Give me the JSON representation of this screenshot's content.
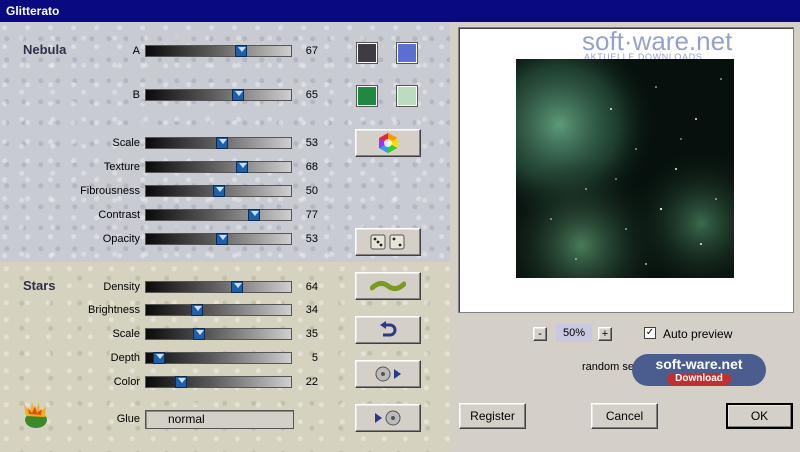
{
  "window": {
    "title": "Glitterato"
  },
  "nebula": {
    "title": "Nebula",
    "sliders": [
      {
        "label": "A",
        "value": 67
      },
      {
        "label": "B",
        "value": 65
      },
      {
        "label": "Scale",
        "value": 53
      },
      {
        "label": "Texture",
        "value": 68
      },
      {
        "label": "Fibrousness",
        "value": 50
      },
      {
        "label": "Contrast",
        "value": 77
      },
      {
        "label": "Opacity",
        "value": 53
      }
    ],
    "colors": {
      "a1": "#3e3a46",
      "a2": "#5a6fd0",
      "b1": "#1f8a3f",
      "b2": "#bcdcc0"
    }
  },
  "stars": {
    "title": "Stars",
    "sliders": [
      {
        "label": "Density",
        "value": 64
      },
      {
        "label": "Brightness",
        "value": 34
      },
      {
        "label": "Scale",
        "value": 35
      },
      {
        "label": "Depth",
        "value": 5
      },
      {
        "label": "Color",
        "value": 22
      }
    ],
    "glue": {
      "label": "Glue",
      "value": "normal"
    }
  },
  "preview": {
    "zoom": "50%",
    "zoom_minus": "-",
    "zoom_plus": "+",
    "auto_preview_label": "Auto preview",
    "auto_preview_checked": "✓",
    "random_settings_label": "random settings"
  },
  "watermark": {
    "brand": "soft·ware.net",
    "sub": "AKTUELLE DOWNLOADS",
    "badge": "soft-ware.net",
    "badge_sub": "Download"
  },
  "buttons": {
    "register": "Register",
    "cancel": "Cancel",
    "ok": "OK"
  }
}
